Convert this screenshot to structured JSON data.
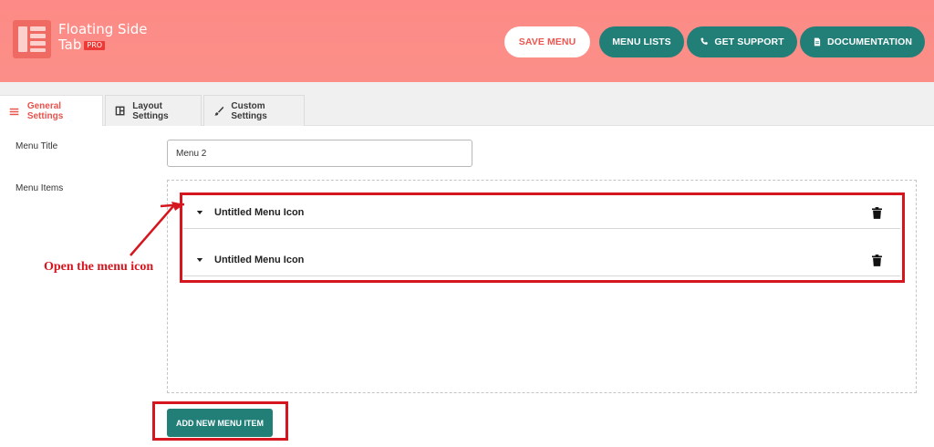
{
  "brand": {
    "title_line1": "Floating Side",
    "title_line2": "Tab",
    "badge": "PRO",
    "logo_icon": "logo-list-icon"
  },
  "header_buttons": {
    "save": "SAVE MENU",
    "lists": "MENU LISTS",
    "support": "GET SUPPORT",
    "docs": "DOCUMENTATION"
  },
  "tabs": [
    {
      "label": "General Settings",
      "icon": "menu-lines-icon",
      "active": true
    },
    {
      "label": "Layout Settings",
      "icon": "layout-icon",
      "active": false
    },
    {
      "label": "Custom Settings",
      "icon": "brush-icon",
      "active": false
    }
  ],
  "form": {
    "menu_title_label": "Menu Title",
    "menu_title_value": "Menu 2",
    "menu_items_label": "Menu Items"
  },
  "menu_items": [
    {
      "title": "Untitled Menu Icon"
    },
    {
      "title": "Untitled Menu Icon"
    }
  ],
  "annotation": "Open the menu icon",
  "add_button": "ADD NEW MENU ITEM",
  "colors": {
    "header": "#fd8a86",
    "accent_teal": "#217f78",
    "accent_red": "#e8524c",
    "annotation_red": "#d6161f"
  }
}
